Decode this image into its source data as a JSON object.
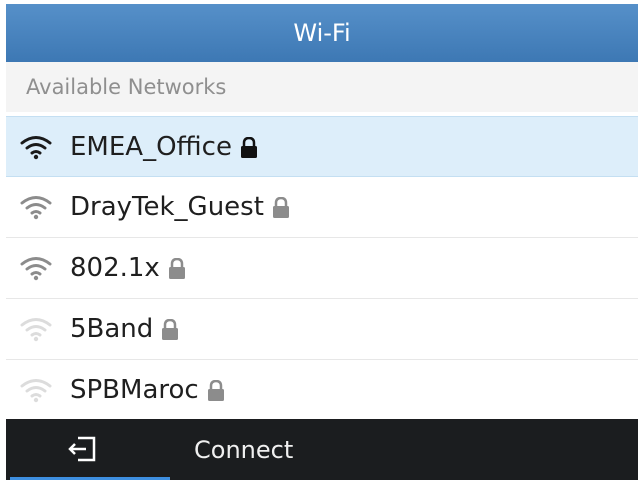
{
  "title": "Wi-Fi",
  "section_label": "Available Networks",
  "networks": [
    {
      "ssid": "EMEA_Office",
      "signal": 4,
      "locked": true,
      "selected": true
    },
    {
      "ssid": "DrayTek_Guest",
      "signal": 3,
      "locked": true,
      "selected": false
    },
    {
      "ssid": "802.1x",
      "signal": 3,
      "locked": true,
      "selected": false
    },
    {
      "ssid": "5Band",
      "signal": 1,
      "locked": true,
      "selected": false
    },
    {
      "ssid": "SPBMaroc",
      "signal": 1,
      "locked": true,
      "selected": false
    }
  ],
  "bottom_bar": {
    "action_label": "Connect",
    "back_icon": "exit-icon"
  },
  "colors": {
    "title_bar": "#4a86c2",
    "selected_row": "#ddeefa",
    "bottom_bar": "#1b1d1f",
    "accent": "#3e8fe0"
  }
}
